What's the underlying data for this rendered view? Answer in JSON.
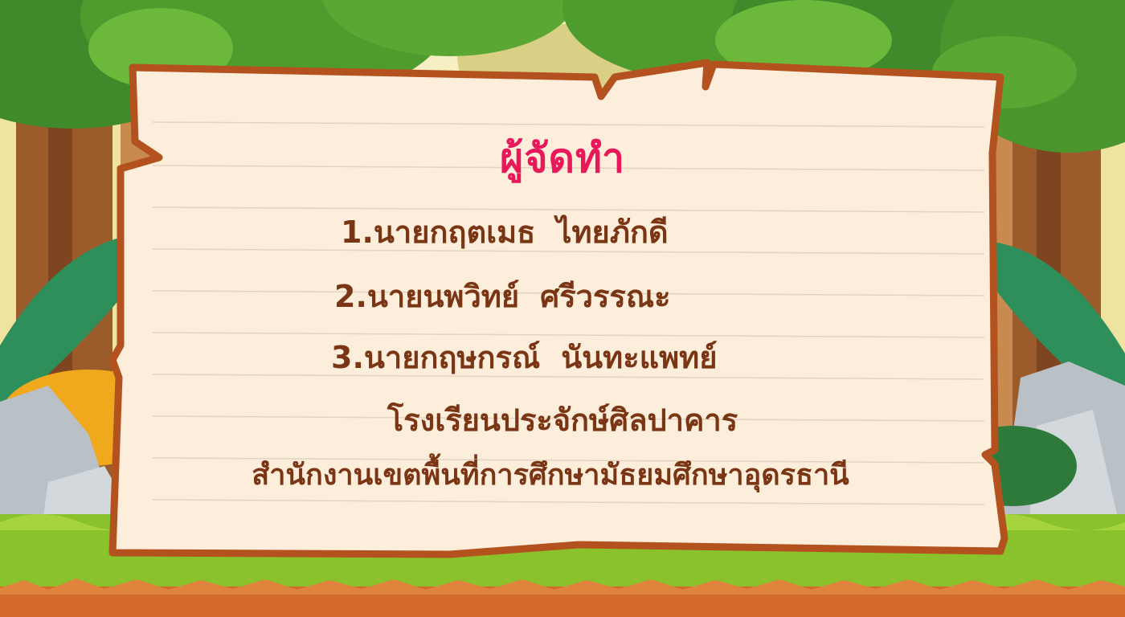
{
  "title": "ผู้จัดทำ",
  "members": [
    {
      "first": "1.นายกฤตเมธ",
      "last": "ไทยภักดี"
    },
    {
      "first": "2.นายนพวิทย์",
      "last": "ศรีวรรณะ"
    },
    {
      "first": "3.นายกฤษกรณ์",
      "last": "นันทะแพทย์"
    }
  ],
  "school": "โรงเรียนประจักษ์ศิลปาคาร",
  "office": "สำนักงานเขตพื้นที่การศึกษามัธยมศึกษาอุดรธานี",
  "colors": {
    "title": "#e8185a",
    "text": "#7a3514",
    "board": "#fdeedb",
    "board_border": "#b3521f",
    "grass": "#8ac22c",
    "soil": "#d56b2b"
  }
}
